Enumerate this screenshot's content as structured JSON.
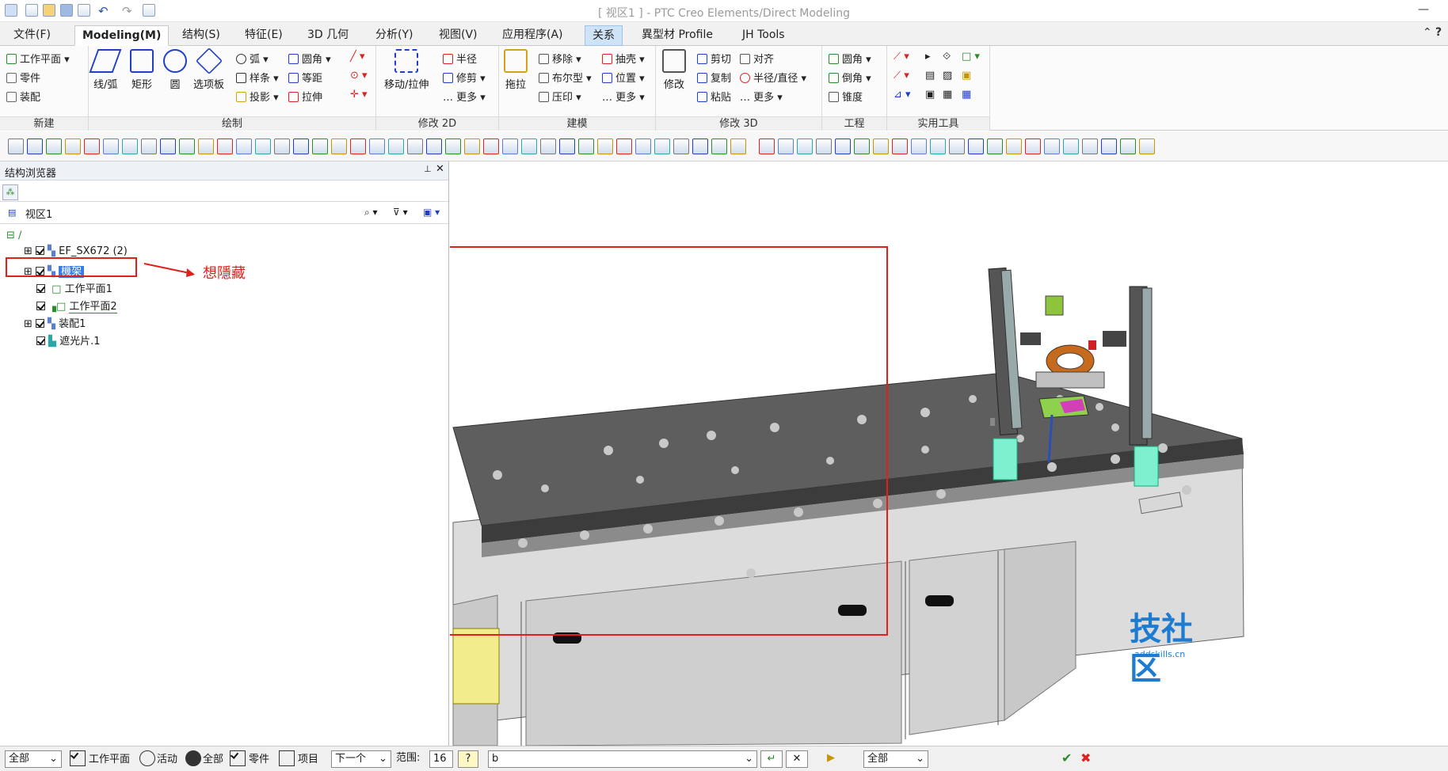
{
  "window": {
    "title": "[ 视区1 ] - PTC Creo Elements/Direct Modeling"
  },
  "menu_tabs": [
    {
      "label": "文件(F)"
    },
    {
      "label": "Modeling(M)"
    },
    {
      "label": "结构(S)"
    },
    {
      "label": "特征(E)"
    },
    {
      "label": "3D 几何"
    },
    {
      "label": "分析(Y)"
    },
    {
      "label": "视图(V)"
    },
    {
      "label": "应用程序(A)"
    },
    {
      "label": "关系"
    },
    {
      "label": "異型材 Profile"
    },
    {
      "label": "JH Tools"
    }
  ],
  "ribbon": {
    "new": {
      "label": "新建",
      "items": [
        "工作平面",
        "零件",
        "装配"
      ]
    },
    "draw": {
      "label": "绘制",
      "big": [
        "线/弧",
        "矩形",
        "圆",
        "选项板"
      ],
      "small": [
        "弧",
        "样条",
        "投影",
        "圆角",
        "等距",
        "拉伸"
      ]
    },
    "modify2d": {
      "label": "修改 2D",
      "big": [
        "移动/拉伸"
      ],
      "small": [
        "半径",
        "修剪",
        "更多"
      ]
    },
    "build": {
      "label": "建模",
      "big": [
        "拖拉"
      ],
      "small": [
        "移除",
        "布尔型",
        "压印",
        "抽壳",
        "位置",
        "更多"
      ]
    },
    "modify3d": {
      "label": "修改 3D",
      "big": [
        "修改"
      ],
      "small": [
        "剪切",
        "复制",
        "粘贴",
        "对齐",
        "半径/直径",
        "更多"
      ]
    },
    "engineering": {
      "label": "工程",
      "small": [
        "圆角",
        "倒角",
        "锥度"
      ]
    },
    "utilities": {
      "label": "实用工具"
    }
  },
  "browser": {
    "title": "结构浏览器",
    "view": "视区1",
    "items": [
      {
        "label": "EF_SX672 (2)"
      },
      {
        "label": "機架"
      },
      {
        "label": "工作平面1"
      },
      {
        "label": "工作平面2"
      },
      {
        "label": "装配1"
      },
      {
        "label": "遮光片.1"
      }
    ]
  },
  "annotation": {
    "text": "想隱藏"
  },
  "status": {
    "filter": "全部",
    "chk_workplane": "工作平面",
    "radio_active": "活动",
    "radio_all": "全部",
    "chk_part": "零件",
    "chk_item": "项目",
    "next": "下一个",
    "range_label": "范围:",
    "range_value": "16",
    "command": "b",
    "filter2": "全部"
  },
  "watermark": {
    "title": "技社区",
    "url": "addskills.cn"
  },
  "colors": {
    "accent": "#1f3fc7",
    "selection": "#3b7ddd",
    "annotation": "#e0211b"
  }
}
